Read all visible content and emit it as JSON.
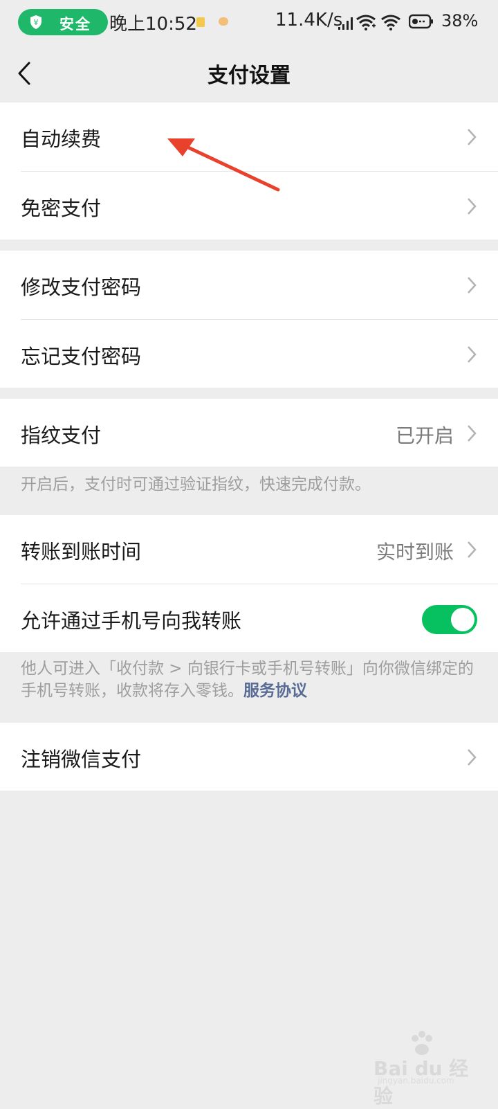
{
  "status_bar": {
    "safe_label": "安全",
    "time": "晚上10:52",
    "net_speed": "11.4K/s",
    "battery": "38%"
  },
  "nav": {
    "title": "支付设置"
  },
  "groups": {
    "auto_renew": {
      "label": "自动续费"
    },
    "password_free": {
      "label": "免密支付"
    },
    "change_password": {
      "label": "修改支付密码"
    },
    "forgot_password": {
      "label": "忘记支付密码"
    },
    "fingerprint": {
      "label": "指纹支付",
      "value": "已开启"
    },
    "fingerprint_note": "开启后，支付时可通过验证指纹，快速完成付款。",
    "transfer_time": {
      "label": "转账到账时间",
      "value": "实时到账"
    },
    "phone_transfer": {
      "label": "允许通过手机号向我转账",
      "enabled": true
    },
    "phone_note": "他人可进入「收付款 > 向银行卡或手机号转账」向你微信绑定的手机号转账，收款将存入零钱。",
    "phone_note_link": "服务协议",
    "close_pay": {
      "label": "注销微信支付"
    }
  },
  "watermark": {
    "text": "Bai du 经验",
    "sub": "jingyan.baidu.com"
  },
  "colors": {
    "accent": "#07c160",
    "link": "#576b95",
    "annotation_arrow": "#e8412c"
  }
}
